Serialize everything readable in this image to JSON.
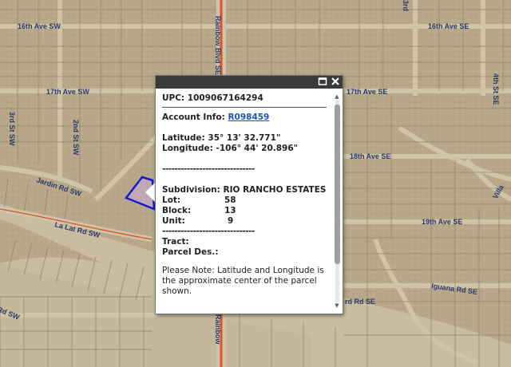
{
  "map": {
    "colors": {
      "terrain": "#b8a889",
      "street": "#cfc3a8",
      "parcel_line": "#8c8470",
      "highway": "#d8532f",
      "parcel_highlight": "#1a1ad0"
    },
    "road_labels": {
      "ave16_sw": "16th Ave SW",
      "ave16_se": "16th Ave SE",
      "ave17_sw": "17th Ave SW",
      "ave17_se": "17th Ave SE",
      "st3_sw": "3rd St SW",
      "st2_sw": "2nd St SW",
      "jardin": "Jardin Rd SW",
      "lariat": "La Lat Rd SW",
      "ave18_se": "18th Ave SE",
      "ave19_se": "19th Ave SE",
      "iguana": "Iguana Rd SE",
      "rd_se": "rd Rd SE",
      "rd_sw": "Rd SW",
      "rainbow_top": "Rainbow Blvd SE",
      "rainbow_bottom": "Rainbow",
      "st4_se": "4th St SE",
      "st3_top": "3rd",
      "villa": "Villa"
    }
  },
  "popup": {
    "icons": {
      "maximize": "maximize-icon",
      "close": "close-icon"
    },
    "upc_label": "UPC:",
    "upc_value": "1009067164294",
    "account_label": "Account Info:",
    "account_value": "R098459",
    "latitude_label": "Latitude:",
    "latitude_value": "35° 13' 32.771\"",
    "longitude_label": "Longitude:",
    "longitude_value": "-106° 44' 20.896\"",
    "divider": "------------------------------",
    "subdivision_label": "Subdivision:",
    "subdivision_value": "RIO RANCHO ESTATES",
    "lot_label": "Lot:",
    "lot_value": "58",
    "block_label": "Block:",
    "block_value": "13",
    "unit_label": "Unit:",
    "unit_value": "9",
    "tract_label": "Tract:",
    "parcel_des_label": "Parcel Des.:",
    "note": "Please Note: Latitude and Longitude is the approximate center of the parcel shown."
  }
}
